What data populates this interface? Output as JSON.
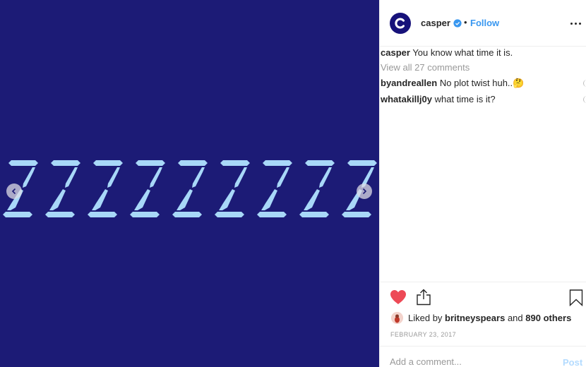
{
  "media": {
    "background_color": "#1c1b76",
    "glyph_color": "#a8d8f8",
    "repeated_glyph": "Z",
    "glyph_count": 10,
    "prev_label": "previous",
    "next_label": "next"
  },
  "post": {
    "author": "casper",
    "verified": true,
    "separator": "•",
    "follow_label": "Follow",
    "more_label": "More options",
    "caption": {
      "username": "casper",
      "text": "You know what time it is."
    },
    "view_all_comments": "View all 27 comments",
    "comments": [
      {
        "username": "byandreallen",
        "text": "No plot twist huh..🤔"
      },
      {
        "username": "whatakillj0y",
        "text": "what time is it?"
      }
    ],
    "likes": {
      "prefix": "Liked by",
      "user": "britneyspears",
      "middle": "and",
      "others": "890 others"
    },
    "date": "FEBRUARY 23, 2017",
    "comment_box": {
      "placeholder": "Add a comment...",
      "value": "",
      "post_label": "Post"
    }
  },
  "colors": {
    "brand": "#17127a",
    "link": "#3897f0",
    "like_red": "#ed4956",
    "muted": "#999999",
    "post_disabled": "#b3dbff"
  }
}
